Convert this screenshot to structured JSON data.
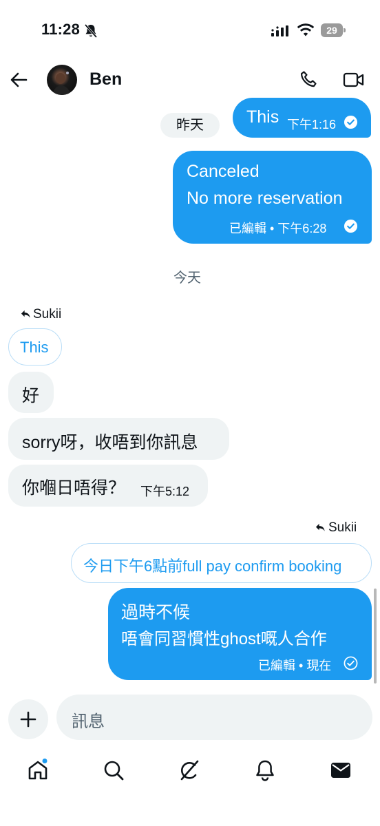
{
  "status_bar": {
    "time": "11:28",
    "battery": "29"
  },
  "header": {
    "contact_name": "Ben"
  },
  "colors": {
    "accent": "#1d9bf0",
    "bubble_incoming": "#eff3f4",
    "text": "#0f1419",
    "muted": "#536471"
  },
  "conversation": {
    "yesterday_label": "昨天",
    "today_label": "今天",
    "msg1": {
      "text": "This",
      "time": "下午1:16"
    },
    "msg2": {
      "line1": "Canceled",
      "line2": "No more reservation",
      "meta": "已編輯 • 下午6:28"
    },
    "incoming_reply_to": "Sukii",
    "incoming_quote": "This",
    "incoming": [
      {
        "text": "好"
      },
      {
        "text": "sorry呀，收唔到你訊息"
      },
      {
        "text": "你嗰日唔得？",
        "time": "下午5:12"
      }
    ],
    "outgoing_reply_to": "Sukii",
    "outgoing_quote": "今日下午6點前full pay confirm booking",
    "msg_last": {
      "line1": "過時不候",
      "line2": "唔會同習慣性ghost嘅人合作",
      "meta": "已編輯 • 現在"
    }
  },
  "composer": {
    "placeholder": "訊息"
  },
  "nav": {
    "items": [
      "home-icon",
      "search-icon",
      "grok-icon",
      "notifications-icon",
      "messages-icon"
    ]
  }
}
